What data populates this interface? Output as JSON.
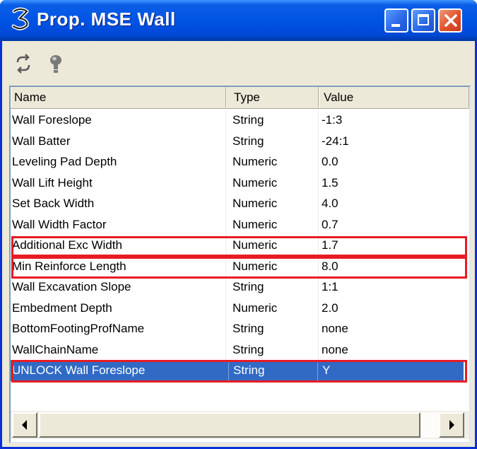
{
  "window": {
    "title": "Prop. MSE Wall",
    "accent_color": "#0054e3",
    "close_color": "#e0512c"
  },
  "toolbar": {
    "icons": [
      "refresh-icon",
      "help-icon"
    ]
  },
  "table": {
    "columns": [
      "Name",
      "Type",
      "Value"
    ],
    "rows": [
      {
        "name": "Wall Foreslope",
        "type": "String",
        "value": "-1:3"
      },
      {
        "name": "Wall Batter",
        "type": "String",
        "value": "-24:1"
      },
      {
        "name": "Leveling Pad Depth",
        "type": "Numeric",
        "value": "0.0"
      },
      {
        "name": "Wall Lift Height",
        "type": "Numeric",
        "value": "1.5"
      },
      {
        "name": "Set Back Width",
        "type": "Numeric",
        "value": "4.0"
      },
      {
        "name": "Wall Width Factor",
        "type": "Numeric",
        "value": "0.7"
      },
      {
        "name": "Additional Exc Width",
        "type": "Numeric",
        "value": "1.7"
      },
      {
        "name": "Min Reinforce Length",
        "type": "Numeric",
        "value": "8.0"
      },
      {
        "name": "Wall Excavation Slope",
        "type": "String",
        "value": "1:1"
      },
      {
        "name": "Embedment Depth",
        "type": "Numeric",
        "value": "2.0"
      },
      {
        "name": "BottomFootingProfName",
        "type": "String",
        "value": "none"
      },
      {
        "name": "WallChainName",
        "type": "String",
        "value": "none"
      },
      {
        "name": "UNLOCK Wall Foreslope",
        "type": "String",
        "value": "Y"
      }
    ],
    "selected_row": "UNLOCK Wall Foreslope",
    "selection_color": "#316ac5",
    "highlight_color": "#e81b23"
  }
}
